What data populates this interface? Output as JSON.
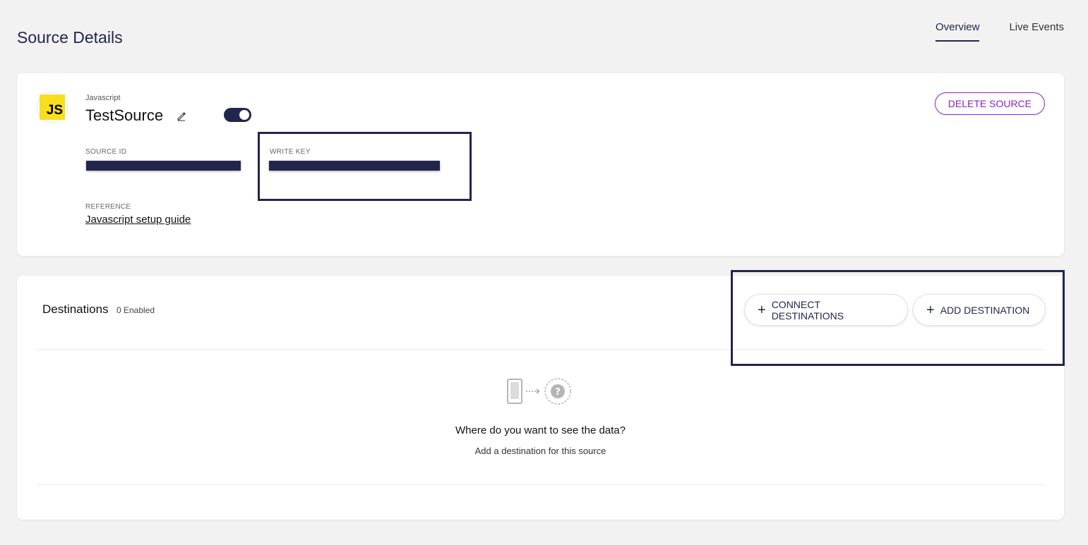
{
  "page": {
    "title": "Source Details"
  },
  "tabs": [
    {
      "label": "Overview",
      "active": true
    },
    {
      "label": "Live Events",
      "active": false
    }
  ],
  "source": {
    "logo_text": "JS",
    "type": "Javascript",
    "name": "TestSource",
    "enabled": true,
    "source_id_label": "SOURCE ID",
    "write_key_label": "WRITE KEY",
    "reference_label": "REFERENCE",
    "reference_link": "Javascript setup guide",
    "delete_label": "DELETE SOURCE"
  },
  "destinations": {
    "title": "Destinations",
    "count_text": "0 Enabled",
    "connect_label": "CONNECT DESTINATIONS",
    "add_label": "ADD DESTINATION",
    "empty_title": "Where do you want to see the data?",
    "empty_subtitle": "Add a destination for this source"
  },
  "colors": {
    "navy": "#22264d",
    "purple_accent": "#8a21c2",
    "js_yellow": "#f7df1e",
    "background": "#f2f2f2"
  },
  "icons": [
    "edit-pencil-icon",
    "plus-icon",
    "device-icon",
    "arrow-icon",
    "question-icon"
  ]
}
